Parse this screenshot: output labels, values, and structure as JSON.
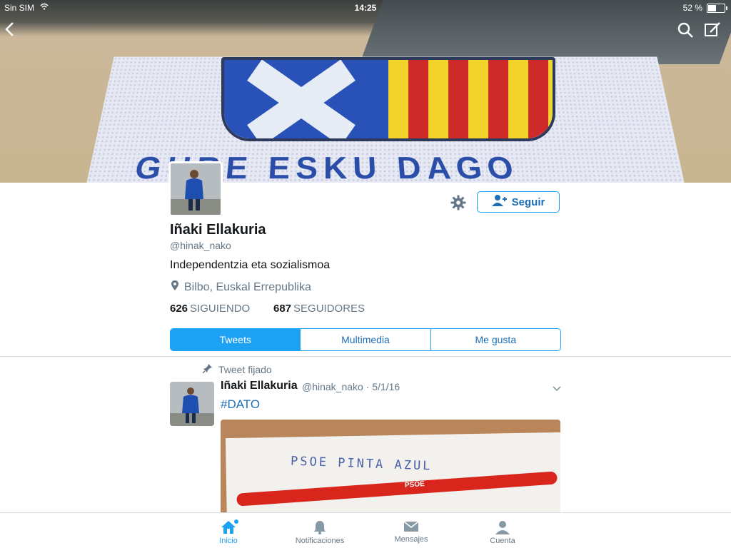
{
  "status_bar": {
    "carrier": "Sin SIM",
    "time": "14:25",
    "battery_text": "52 %",
    "battery_level": 0.52
  },
  "profile": {
    "name": "Iñaki Ellakuria",
    "handle": "@hinak_nako",
    "bio": "Independentzia eta sozialismoa",
    "location": "Bilbo, Euskal Errepublika",
    "following_count": "626",
    "following_label": "SIGUIENDO",
    "followers_count": "687",
    "followers_label": "SEGUIDORES",
    "follow_button": "Seguir",
    "banner_text": "GURE ESKU DAGO"
  },
  "tabs": [
    {
      "label": "Tweets",
      "active": true
    },
    {
      "label": "Multimedia",
      "active": false
    },
    {
      "label": "Me gusta",
      "active": false
    }
  ],
  "tweet": {
    "pinned_label": "Tweet fijado",
    "author": "Iñaki Ellakuria",
    "handle": "@hinak_nako",
    "date": "5/1/16",
    "separator": "·",
    "text": "#DATO",
    "media_note": "PSOE PINTA AZUL",
    "media_pen_label": "PSOE"
  },
  "bottom_nav": [
    {
      "label": "Inicio",
      "icon": "home-icon",
      "active": true
    },
    {
      "label": "Notificaciones",
      "icon": "bell-icon",
      "active": false
    },
    {
      "label": "Mensajes",
      "icon": "envelope-icon",
      "active": false
    },
    {
      "label": "Cuenta",
      "icon": "person-icon",
      "active": false
    }
  ],
  "colors": {
    "accent": "#1da1f2",
    "text": "#14171a",
    "muted": "#657786"
  }
}
